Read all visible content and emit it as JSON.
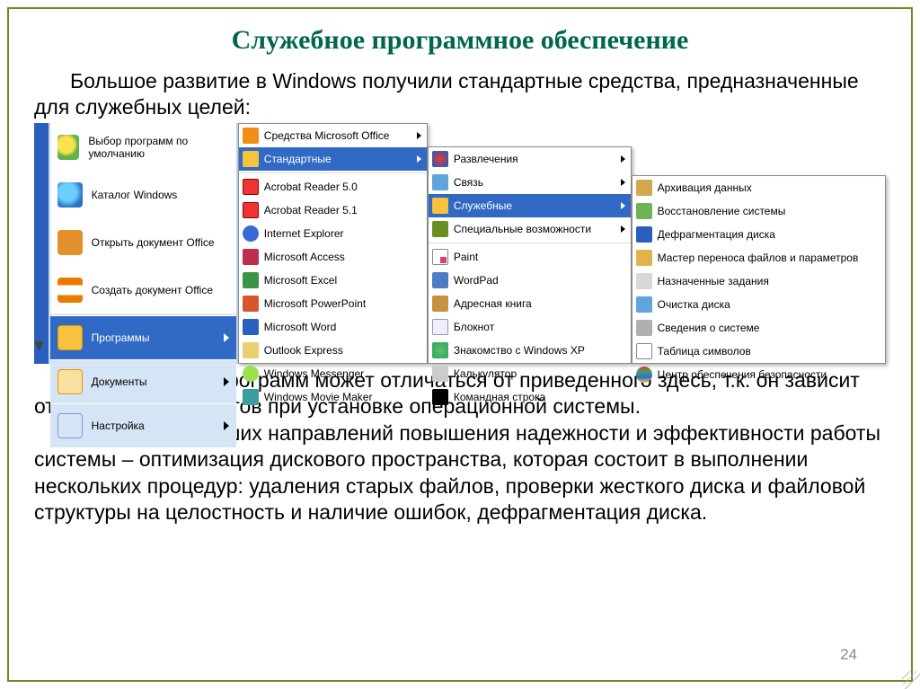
{
  "title": "Служебное программное обеспечение",
  "para1": "Большое развитие в Windows получили стандартные средства, предназначенные для служебных целей:",
  "para2": "Перечень этих программ может отличаться от приведенного здесь, т.к. он зависит от выбора компонентов при установке операционной системы.",
  "para3": "Одно из важнейших направлений повышения надежности и эффективности работы системы – оптимизация дискового пространства, которая состоит в выполнении нескольких процедур: удаления старых файлов, проверки жесткого диска и файловой структуры на целостность и наличие ошибок, дефрагментация диска.",
  "page_number": "24",
  "start_left": {
    "default_programs": "Выбор программ по умолчанию",
    "catalog": "Каталог Windows",
    "open_office": "Открыть документ Office",
    "new_office": "Создать документ Office",
    "programs": "Программы",
    "documents": "Документы",
    "settings": "Настройка"
  },
  "menu_programs": {
    "office_tools": "Средства Microsoft Office",
    "standard": "Стандартные",
    "acro50": "Acrobat Reader 5.0",
    "acro51": "Acrobat Reader 5.1",
    "ie": "Internet Explorer",
    "access": "Microsoft Access",
    "excel": "Microsoft Excel",
    "ppt": "Microsoft PowerPoint",
    "word": "Microsoft Word",
    "outlook": "Outlook Express",
    "messenger": "Windows Messenger",
    "movie": "Windows Movie Maker"
  },
  "menu_standard": {
    "games": "Развлечения",
    "comm": "Связь",
    "service": "Служебные",
    "special": "Специальные возможности",
    "paint": "Paint",
    "wordpad": "WordPad",
    "addressbook": "Адресная книга",
    "notepad": "Блокнот",
    "tour": "Знакомство с Windows XP",
    "calc": "Калькулятор",
    "cmd": "Командная строка"
  },
  "menu_service": {
    "backup": "Архивация данных",
    "restore": "Восстановление системы",
    "defrag": "Дефрагментация диска",
    "wizard": "Мастер переноса файлов и параметров",
    "sched": "Назначенные задания",
    "clean": "Очистка диска",
    "sysinfo": "Сведения о системе",
    "charmap": "Таблица символов",
    "security": "Центр обеспечения безопасности"
  }
}
